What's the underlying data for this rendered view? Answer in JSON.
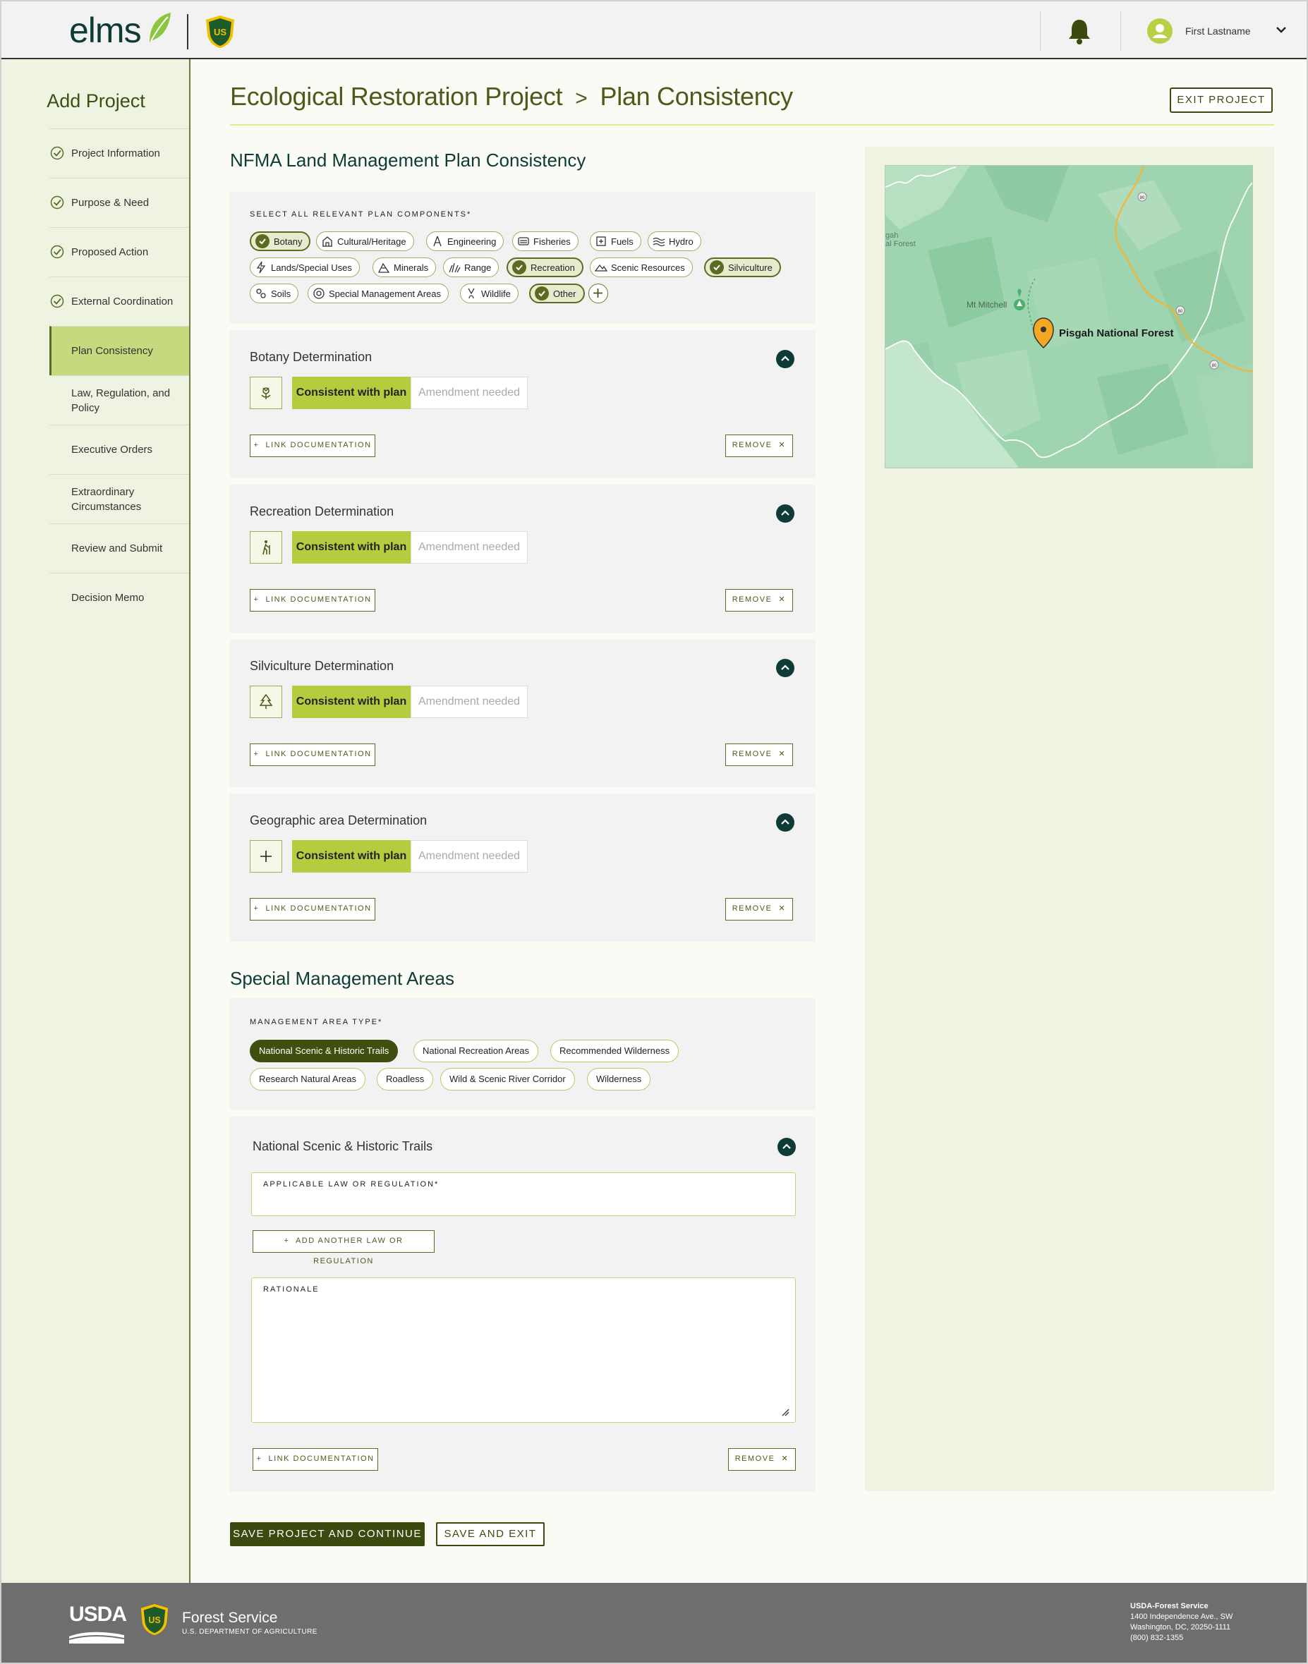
{
  "header": {
    "logo_text": "elms",
    "user_name": "First Lastname"
  },
  "sidebar": {
    "title": "Add Project",
    "items": [
      {
        "label": "Project Information",
        "done": true
      },
      {
        "label": "Purpose & Need",
        "done": true
      },
      {
        "label": "Proposed Action",
        "done": true
      },
      {
        "label": "External Coordination",
        "done": true
      },
      {
        "label": "Plan Consistency",
        "active": true
      },
      {
        "label": "Law, Regulation, and Policy"
      },
      {
        "label": "Executive Orders"
      },
      {
        "label": "Extraordinary Circumstances"
      },
      {
        "label": "Review and Submit"
      },
      {
        "label": "Decision Memo"
      }
    ]
  },
  "page": {
    "project_name": "Ecological Restoration Project",
    "separator": ">",
    "step_name": "Plan Consistency",
    "exit_label": "EXIT PROJECT"
  },
  "nfma": {
    "title": "NFMA Land Management Plan Consistency",
    "components_label": "SELECT ALL RELEVANT PLAN COMPONENTS*",
    "components": [
      {
        "label": "Botany",
        "selected": true
      },
      {
        "label": "Cultural/Heritage",
        "icon": "building-icon"
      },
      {
        "label": "Engineering",
        "icon": "compass-icon"
      },
      {
        "label": "Fisheries",
        "icon": "fish-icon"
      },
      {
        "label": "Fuels",
        "icon": "fuel-icon"
      },
      {
        "label": "Hydro",
        "icon": "waves-icon"
      },
      {
        "label": "Lands/Special Uses",
        "icon": "lightning-icon"
      },
      {
        "label": "Minerals",
        "icon": "minerals-icon"
      },
      {
        "label": "Range",
        "icon": "grass-icon"
      },
      {
        "label": "Recreation",
        "selected": true
      },
      {
        "label": "Scenic Resources",
        "icon": "mountain-icon"
      },
      {
        "label": "Silviculture",
        "selected": true
      },
      {
        "label": "Soils",
        "icon": "soil-icon"
      },
      {
        "label": "Special Management Areas",
        "icon": "target-icon"
      },
      {
        "label": "Wildlife",
        "icon": "paw-icon"
      },
      {
        "label": "Other",
        "selected": true
      }
    ]
  },
  "determinations": [
    {
      "title": "Botany Determination",
      "icon": "flower-icon"
    },
    {
      "title": "Recreation Determination",
      "icon": "hiker-icon"
    },
    {
      "title": "Silviculture Determination",
      "icon": "tree-icon"
    },
    {
      "title": "Geographic area Determination",
      "icon": "plus-icon"
    }
  ],
  "determination_controls": {
    "consistent_label": "Consistent with plan",
    "amendment_label": "Amendment needed",
    "link_label": "LINK DOCUMENTATION",
    "remove_label": "REMOVE"
  },
  "sma": {
    "title": "Special Management Areas",
    "type_label": "MANAGEMENT AREA TYPE*",
    "types": [
      {
        "label": "National Scenic & Historic Trails",
        "selected": true
      },
      {
        "label": "National Recreation Areas"
      },
      {
        "label": "Recommended Wilderness"
      },
      {
        "label": "Research Natural Areas"
      },
      {
        "label": "Roadless"
      },
      {
        "label": "Wild & Scenic River Corridor"
      },
      {
        "label": "Wilderness"
      }
    ],
    "detail_title": "National Scenic & Historic Trails",
    "law_label": "APPLICABLE LAW OR REGULATION*",
    "law_value": "",
    "add_law_label": "ADD ANOTHER LAW OR REGULATION",
    "rationale_label": "RATIONALE",
    "rationale_value": "",
    "link_label": "LINK DOCUMENTATION",
    "remove_label": "REMOVE"
  },
  "actions": {
    "save_continue": "SAVE PROJECT AND CONTINUE",
    "save_exit": "SAVE AND EXIT"
  },
  "map": {
    "place_label": "Pisgah National Forest",
    "peak_label": "Mt Mitchell",
    "edge_label_1": "gah",
    "edge_label_2": "al Forest",
    "road_shield_1": "80",
    "road_shield_2": "80",
    "road_shield_3": "80"
  },
  "footer": {
    "usda": "USDA",
    "agency": "Forest Service",
    "department": "U.S. DEPARTMENT OF AGRICULTURE",
    "address_title": "USDA-Forest Service",
    "address_line1": "1400 Independence Ave., SW",
    "address_line2": "Washington, DC, 20250-1111",
    "phone": "(800) 832-1355"
  },
  "colors": {
    "brand_dark": "#3b4a0f",
    "accent_green": "#b5cc3e",
    "teal": "#0e3b36",
    "map_marker": "#f5a623"
  }
}
